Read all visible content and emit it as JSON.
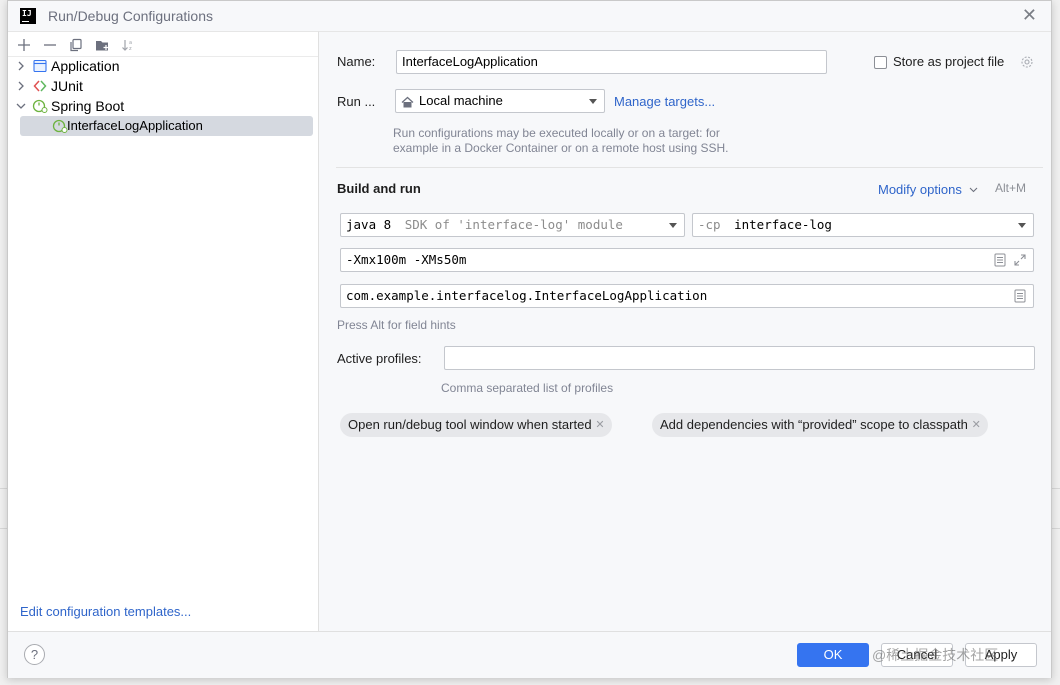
{
  "window": {
    "title": "Run/Debug Configurations",
    "logo_text": "IJ"
  },
  "tree": {
    "items": [
      {
        "label": "Application",
        "expanded": false
      },
      {
        "label": "JUnit",
        "expanded": false
      },
      {
        "label": "Spring Boot",
        "expanded": true
      },
      {
        "label": "InterfaceLogApplication",
        "selected": true
      }
    ]
  },
  "left_footer": {
    "edit_templates": "Edit configuration templates..."
  },
  "form": {
    "name_label": "Name:",
    "name_value": "InterfaceLogApplication",
    "store_label": "Store as project file",
    "store_checked": false,
    "run_on_label": "Run ...",
    "run_on_value": "Local machine",
    "manage_targets": "Manage targets...",
    "run_hint_line1": "Run configurations may be executed locally or on a target: for",
    "run_hint_line2": "example in a Docker Container or on a remote host using SSH.",
    "build_run_title": "Build and run",
    "modify_options": "Modify options",
    "modify_shortcut": "Alt+M",
    "jdk_main": "java 8",
    "jdk_detail": "SDK of 'interface-log' module",
    "cp_flag": "-cp",
    "cp_value": "interface-log",
    "vm_options": "-Xmx100m -XMs50m",
    "main_class": "com.example.interfacelog.InterfaceLogApplication",
    "field_hints": "Press Alt for field hints",
    "active_profiles_label": "Active profiles:",
    "active_profiles_value": "",
    "profiles_hint": "Comma separated list of profiles",
    "chips": [
      "Open run/debug tool window when started",
      "Add dependencies with “provided” scope to classpath"
    ]
  },
  "footer": {
    "help": "?",
    "ok": "OK",
    "cancel": "Cancel",
    "apply": "Apply",
    "watermark": "@稀土掘金技术社区"
  },
  "colors": {
    "accent": "#3574f0",
    "link": "#2f65ca",
    "selection": "#d5d9e0",
    "spring_green": "#6db33f",
    "junit_red": "#e05252",
    "junit_green": "#5fb85f"
  }
}
